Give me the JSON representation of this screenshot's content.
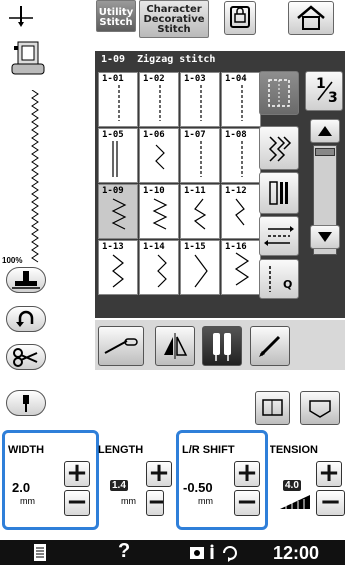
{
  "tabs": {
    "utility": "Utility\nStitch",
    "character": "Character\nDecorative\nStitch"
  },
  "pattern_title": "1-09  Zigzag stitch",
  "stitch_cells": [
    {
      "id": "1-01"
    },
    {
      "id": "1-02"
    },
    {
      "id": "1-03"
    },
    {
      "id": "1-04"
    },
    {
      "id": "1-05"
    },
    {
      "id": "1-06"
    },
    {
      "id": "1-07"
    },
    {
      "id": "1-08"
    },
    {
      "id": "1-09"
    },
    {
      "id": "1-10"
    },
    {
      "id": "1-11"
    },
    {
      "id": "1-12"
    },
    {
      "id": "1-13"
    },
    {
      "id": "1-14"
    },
    {
      "id": "1-15"
    },
    {
      "id": "1-16"
    }
  ],
  "selected_stitch": "1-09",
  "page_indicator": {
    "current": "1",
    "total": "3"
  },
  "zoom_label": "100%",
  "settings": {
    "width": {
      "label": "WIDTH",
      "value": "2.0",
      "unit": "mm"
    },
    "length": {
      "label": "LENGTH",
      "value": "1.4",
      "unit": "mm"
    },
    "lr_shift": {
      "label": "L/R SHIFT",
      "value": "-0.50",
      "unit": "mm"
    },
    "tension": {
      "label": "TENSION",
      "value": "4.0"
    }
  },
  "side_q": "Q",
  "status_bar": {
    "help": "?",
    "time": "12:00"
  },
  "colors": {
    "highlight": "#2f7fd9",
    "grid_bg": "#3a3a3a",
    "status_bg": "#111111"
  }
}
